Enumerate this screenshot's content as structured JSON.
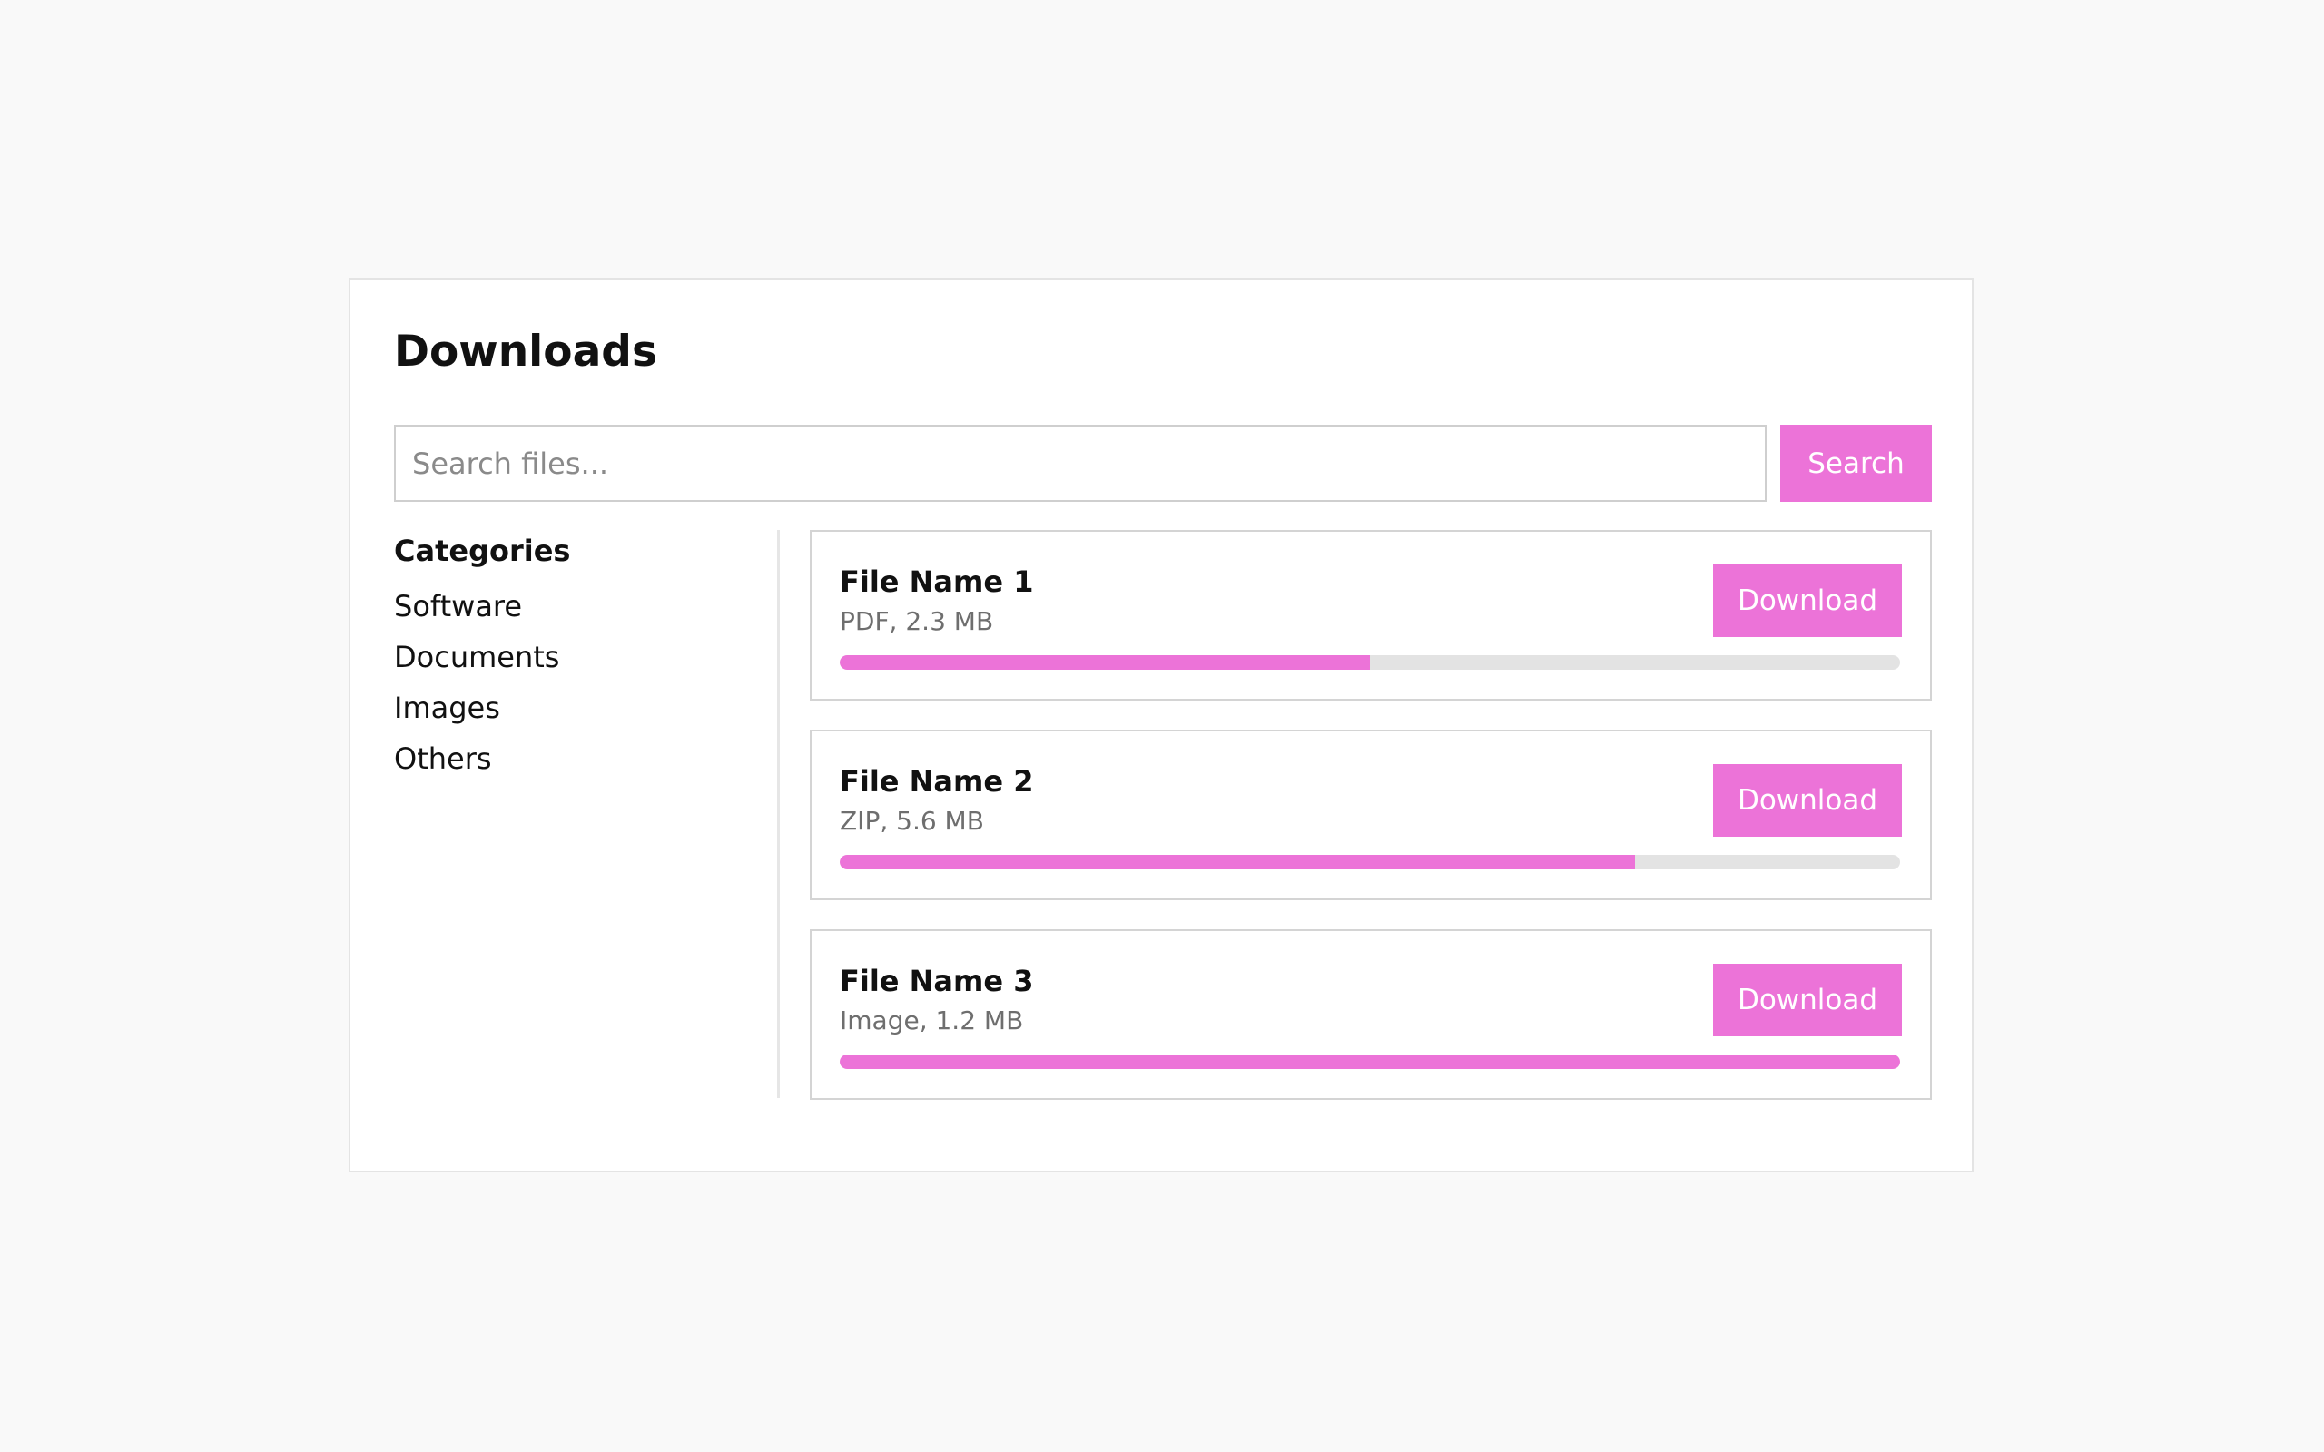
{
  "page": {
    "title": "Downloads"
  },
  "search": {
    "placeholder": "Search files...",
    "value": "",
    "button_label": "Search"
  },
  "sidebar": {
    "heading": "Categories",
    "items": [
      {
        "label": "Software"
      },
      {
        "label": "Documents"
      },
      {
        "label": "Images"
      },
      {
        "label": "Others"
      }
    ]
  },
  "files": [
    {
      "name": "File Name 1",
      "meta": "PDF, 2.3 MB",
      "progress": 0.5,
      "button_label": "Download"
    },
    {
      "name": "File Name 2",
      "meta": "ZIP, 5.6 MB",
      "progress": 0.75,
      "button_label": "Download"
    },
    {
      "name": "File Name 3",
      "meta": "Image, 1.2 MB",
      "progress": 1.0,
      "button_label": "Download"
    }
  ],
  "colors": {
    "accent": "#ec73d8",
    "progress_track": "#e3e3e3",
    "background": "#f9f9f9",
    "panel": "#ffffff",
    "muted_text": "#6e6e6e"
  },
  "icons": []
}
